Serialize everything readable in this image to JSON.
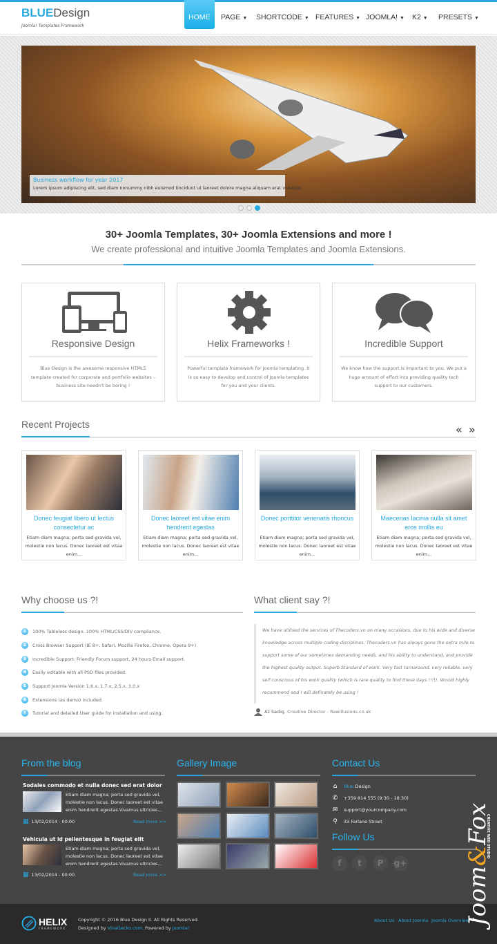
{
  "header": {
    "logo_bold": "BLUE",
    "logo_rest": "Design",
    "tagline": "Joomla! Templates Framework",
    "nav": [
      {
        "label": "HOME",
        "active": true
      },
      {
        "label": "PAGE"
      },
      {
        "label": "SHORTCODE"
      },
      {
        "label": "FEATURES"
      },
      {
        "label": "JOOMLA!"
      },
      {
        "label": "K2"
      },
      {
        "label": "PRESETS"
      }
    ]
  },
  "slider": {
    "caption_title": "Business workflow for year 2017",
    "caption_text": "Lorem ipsum adipiscing elit, sed diam nonummy nibh euismod tincidunt ut laoreet dolore magna aliquam erat volutpat.",
    "slides": 3,
    "active_slide": 3
  },
  "intro": {
    "title": "30+ Joomla Templates, 30+ Joomla Extensions and more !",
    "subtitle": "We create professional and intuitive Joomla Templates and Joomla Extensions."
  },
  "features": [
    {
      "icon": "responsive-devices-icon",
      "title": "Responsive Design",
      "text": "Blue Design is the awesome responsive HTML5 template created for corporate and portfolio websites – business site needn't be boring !"
    },
    {
      "icon": "gear-icon",
      "title": "Helix Frameworks !",
      "text": "Powerful template framework for Joomla templating. It is so easy to develop and control of Joomla templates for you and your clients."
    },
    {
      "icon": "chat-bubbles-icon",
      "title": "Incredible Support",
      "text": "We know how the support is important to you. We put a huge amount of effort into providing quality tech support to our customers."
    }
  ],
  "projects": {
    "title": "Recent Projects",
    "prev": "«",
    "next": "»",
    "items": [
      {
        "title": "Donec feugiat libero ut lectus consectetur ac",
        "text": "Etiam diam magna; porta sed gravida vel, molestie non lacus. Donec laoreet est vitae enim..."
      },
      {
        "title": "Donec laoreet est vitae enim hendrerit egestas",
        "text": "Etiam diam magna; porta sed gravida vel, molestie non lacus. Donec laoreet est vitae enim..."
      },
      {
        "title": "Donec porttitor venenatis rhoncus",
        "text": "Etiam diam magna; porta sed gravida vel, molestie non lacus. Donec laoreet est vitae enim..."
      },
      {
        "title": "Maecenas lacinia nulla sit amet eros mollis eu",
        "text": "Etiam diam magna; porta sed gravida vel, molestie non lacus. Donec laoreet est vitae enim..."
      }
    ]
  },
  "why": {
    "title": "Why choose us ?!",
    "items": [
      "100% Tableless design. 100% HTML/CSS/DIV compliance.",
      "Cross Browser Support (IE 8+, Safari, Mozilla Firefox, Chrome, Opera 9+)",
      "Incredible Support: Friendly Forum support, 24 hours Email support.",
      "Easily editable with all PSD files provided.",
      "Support Joomla Version 1.6.x, 1.7.x, 2.5.x, 3.0.x",
      "Extensions (as demo) included.",
      "Tutorial and detailed User guide for installation and using."
    ]
  },
  "client": {
    "title": "What client say ?!",
    "quote": "We have utilised the services of Thecoders.vn on many occasions, due to his wide and diverse knowledge across multiple coding disciplines. Thecoders.vn has always gone the extra mile to support some of our sometimes demanding needs, and his ability to understand, and provide the highest quality output. Superb Standard of work. Very fast turnaround, very reliable, very self conscious of his work quality (which is rare quality to find these days !!!!). Would highly recommend and I will definately be using !",
    "author": "Az Sadiq,",
    "role": "Creative Director - Rawillusions.co.uk"
  },
  "footer": {
    "blog": {
      "title": "From the blog",
      "posts": [
        {
          "title": "Sodales commodo et nulla donec sed erat dolor",
          "text": "Etiam diam magna; porta sed gravida vel, molestie non lacus. Donec laoreet est vitae enim hendrerit egestas.Vivamus ultricies...",
          "date": "13/02/2014 - 00:00",
          "more": "Read more >>"
        },
        {
          "title": "Vehicula ut id pellentesque in feugiat elit",
          "text": "Etiam diam magna; porta sed gravida vel, molestie non lacus. Donec laoreet est vitae enim hendrerit egestas.Vivamus ultricies...",
          "date": "13/02/2014 - 00:00",
          "more": "Read more >>"
        }
      ]
    },
    "gallery": {
      "title": "Gallery Image",
      "count": 9
    },
    "contact": {
      "title": "Contact Us",
      "name_blue": "Blue",
      "name_rest": " Design",
      "phone": "+359 814 555 (9:30 - 18:30)",
      "email": "support@yourcompany.com",
      "address": "33 Farlane Street"
    },
    "follow": {
      "title": "Follow Us",
      "icons": [
        "facebook-icon",
        "twitter-icon",
        "pinterest-icon",
        "google-plus-icon"
      ]
    }
  },
  "bottom": {
    "logo": "HELIX",
    "logo_sub": "FRAMEWORK",
    "copyright": "Copyright © 2016 Blue Design II. All Rights Reserved.",
    "designed_by": "Designed by ",
    "designer": "VinaGecko.com",
    "powered_by": ". Powered by ",
    "powered": "Joomla!",
    "links": [
      "About Us",
      "About Joomla",
      "Joomla Overview"
    ],
    "watermark": "JoomFox",
    "watermark_sub": "CREATIVE WEB STUDIO"
  },
  "colors": {
    "accent": "#27a8e0",
    "footer": "#454545",
    "bottom": "#2a2a2a"
  }
}
